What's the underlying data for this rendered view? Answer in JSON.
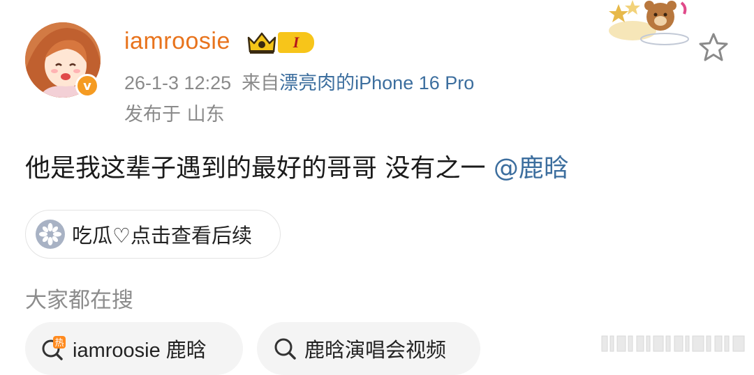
{
  "user": {
    "name": "iamroosie",
    "level": "I",
    "verified": "v"
  },
  "meta": {
    "datetime": "26-1-3 12:25",
    "source_prefix": "来自",
    "device": "漂亮肉的iPhone 16 Pro",
    "location": "发布于 山东"
  },
  "post": {
    "text": "他是我这辈子遇到的最好的哥哥 没有之一 ",
    "mention": "@鹿晗"
  },
  "card": {
    "label": "吃瓜♡点击查看后续",
    "icon": "melon-seed-icon"
  },
  "search": {
    "section_title": "大家都在搜",
    "chips": [
      {
        "label": "iamroosie 鹿晗",
        "icon": "hot-search-icon",
        "hot_badge": "热"
      },
      {
        "label": "鹿晗演唱会视频",
        "icon": "search-icon"
      }
    ]
  },
  "colors": {
    "username": "#e8731c",
    "link": "#3c6e9e",
    "meta_gray": "#8a8a8a",
    "verified": "#f59b22",
    "level_badge": "#f7c51a"
  }
}
